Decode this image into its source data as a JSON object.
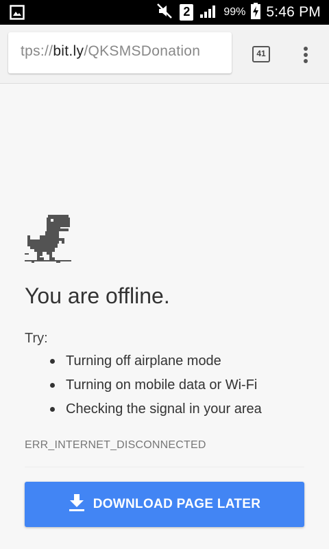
{
  "status_bar": {
    "left_icon": "image-icon",
    "icons": [
      "mute-icon",
      "sim-2-icon",
      "signal-icon"
    ],
    "sim_badge": "2",
    "battery_percent": "99%",
    "battery_icon": "battery-charging-icon",
    "time": "5:46 PM"
  },
  "toolbar": {
    "url": {
      "scheme": "tps://",
      "host": "bit.ly",
      "path": "/QKSMSDonation"
    },
    "tab_count": "41",
    "menu_icon": "overflow-menu-icon"
  },
  "main": {
    "dino_icon": "offline-dinosaur-icon",
    "headline": "You are offline.",
    "try_label": "Try:",
    "suggestions": [
      "Turning off airplane mode",
      "Turning on mobile data or Wi-Fi",
      "Checking the signal in your area"
    ],
    "error_code": "ERR_INTERNET_DISCONNECTED",
    "download_button": {
      "label": "DOWNLOAD PAGE LATER",
      "icon": "download-icon"
    }
  },
  "colors": {
    "button_blue": "#4285f4",
    "page_background": "#f7f7f7",
    "status_bar": "#000000"
  }
}
